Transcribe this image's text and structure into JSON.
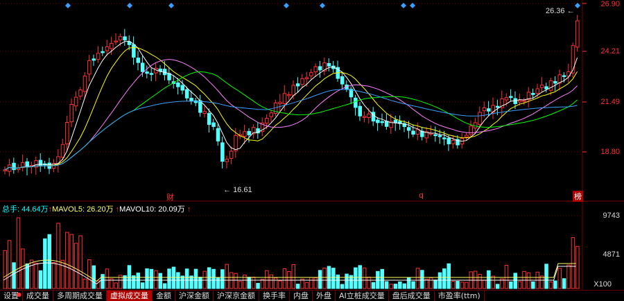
{
  "price_axis": {
    "labels": [
      "26.90",
      "24.21",
      "21.49",
      "18.80"
    ],
    "values": [
      26.9,
      24.21,
      21.49,
      18.8
    ],
    "color": "#ff3232"
  },
  "volume_axis": {
    "labels": [
      "9743",
      "4871"
    ],
    "values": [
      9743,
      4871
    ],
    "multiplier_label": "X100"
  },
  "annotations": {
    "high_label": "26.36",
    "low_label": "16.61"
  },
  "event_markers": [
    {
      "text": "财",
      "color": "#ff3232"
    },
    {
      "text": "q",
      "color": "#ff3232"
    },
    {
      "text": "榜",
      "color": "#ffffff",
      "bg": "#b00000"
    }
  ],
  "volume_legend": {
    "total": "总手: 44.64万",
    "mavol5": "MAVOL5: 26.20万",
    "mavol10": "MAVOL10: 20.09万",
    "arrow": "↑"
  },
  "tabs": [
    {
      "label": "设置",
      "dot": "●",
      "active": false
    },
    {
      "label": "成交量",
      "active": false
    },
    {
      "label": "多周期成交量",
      "active": false
    },
    {
      "label": "虚拟成交量",
      "active": true
    },
    {
      "label": "金额",
      "active": false
    },
    {
      "label": "沪深金额",
      "active": false
    },
    {
      "label": "沪深京金额",
      "active": false
    },
    {
      "label": "换手率",
      "active": false
    },
    {
      "label": "内盘",
      "active": false
    },
    {
      "label": "外盘",
      "active": false
    },
    {
      "label": "AI立桩成交量",
      "active": false
    },
    {
      "label": "盘后成交量",
      "active": false
    },
    {
      "label": "市盈率(ttm)",
      "active": false
    }
  ],
  "colors": {
    "up": "#ff3232",
    "down": "#54ffff",
    "ma5": "#ffffff",
    "ma10": "#ffff00",
    "ma20": "#ff80ff",
    "ma30": "#00ff00",
    "ma60": "#3aa0ff",
    "grid": "#7a0000",
    "diamond": "#3aa0ff"
  }
}
